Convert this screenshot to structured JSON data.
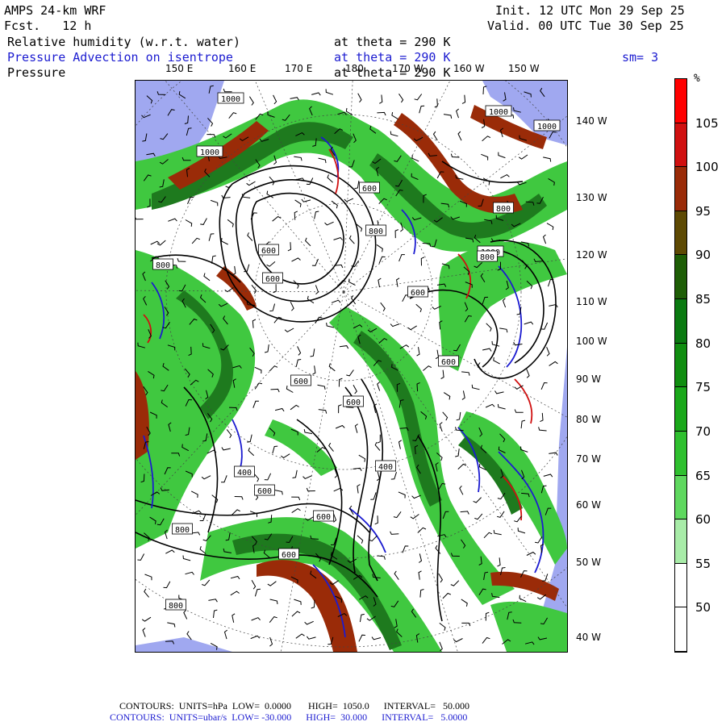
{
  "header": {
    "model": "AMPS 24-km WRF",
    "fcst": "Fcst.   12 h",
    "init": "Init. 12 UTC Mon 29 Sep 25",
    "valid": "Valid. 00 UTC Tue 30 Sep 25"
  },
  "fields": [
    {
      "name": "Relative humidity (w.r.t. water)",
      "level": "at theta = 290 K",
      "color": "#000000"
    },
    {
      "name": "Pressure Advection on isentrope",
      "level": "at theta = 290 K",
      "color": "#1b1bd0",
      "extra": "sm= 3"
    },
    {
      "name": "Pressure",
      "level": "at theta = 290 K",
      "color": "#000000"
    }
  ],
  "longitude_labels": [
    "150 E",
    "160 E",
    "170 E",
    "180",
    "170 W",
    "160 W",
    "150 W"
  ],
  "latitude_labels": [
    "140 W",
    "130 W",
    "120 W",
    "110 W",
    "100 W",
    "90 W",
    "80 W",
    "70 W",
    "60 W",
    "50 W",
    "40 W"
  ],
  "contour_labels": [
    "1000",
    "1000",
    "1000",
    "1000",
    "1000",
    "800",
    "800",
    "800",
    "800",
    "600",
    "600",
    "600",
    "600",
    "600",
    "600",
    "400",
    "400",
    "600",
    "600",
    "600",
    "600",
    "800",
    "800"
  ],
  "colorbar": {
    "unit": "%",
    "labels": [
      "105",
      "100",
      "95",
      "90",
      "85",
      "80",
      "75",
      "70",
      "65",
      "60",
      "55",
      "50"
    ],
    "segments": [
      "#ff0000",
      "#d01010",
      "#9a2b08",
      "#5e4a04",
      "#1e5e06",
      "#0a7a10",
      "#108e10",
      "#1aa81a",
      "#2fc02f",
      "#5fd85f",
      "#a8eca8",
      "#ffffff",
      "#ffffff"
    ]
  },
  "footer": {
    "line1": "CONTOURS:  UNITS=hPa  LOW=  0.0000       HIGH=  1050.0      INTERVAL=   50.000",
    "line2": "CONTOURS:  UNITS=ubar/s  LOW= -30.000      HIGH=  30.000      INTERVAL=   5.0000"
  },
  "colors": {
    "ocean_mask": "#a0a8f0",
    "rh_light": "#40c840",
    "rh_dark": "#1e7a1e",
    "rh_brown": "#9a2b08",
    "advection_pos": "#d01010",
    "advection_neg": "#1b1bd0",
    "contour": "#000000"
  }
}
